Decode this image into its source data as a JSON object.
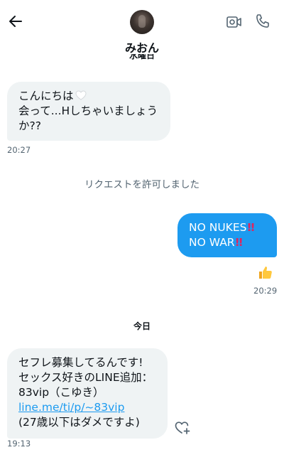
{
  "header": {
    "contact_name": "みおん",
    "cut_text": "水曜日"
  },
  "messages": {
    "m1": {
      "line1": "こんにちは",
      "line2": "会って...Hしちゃいましょう",
      "line3": "か??",
      "time": "20:27"
    },
    "system_notice": "リクエストを許可しました",
    "m2": {
      "line1": "NO NUKES",
      "line2": "NO WAR",
      "time": "20:29"
    },
    "day_label": "今日",
    "m3": {
      "line1": "セフレ募集してるんです!",
      "line2": "セックス好きのLINE追加：",
      "line3": "83vip（こゆき）",
      "link": "line.me/ti/p/~83vip",
      "line5": "(27歳以下はダメですよ)",
      "time": "19:13"
    }
  },
  "colors": {
    "accent": "#1d9bf0",
    "bubble_in": "#eff3f4",
    "muted": "#536471",
    "exclaim": "#e0245e"
  },
  "icons": [
    "back-arrow-icon",
    "video-call-icon",
    "phone-icon",
    "thumbs-up-icon",
    "heart-plus-icon",
    "white-heart-icon",
    "double-exclamation-icon"
  ]
}
